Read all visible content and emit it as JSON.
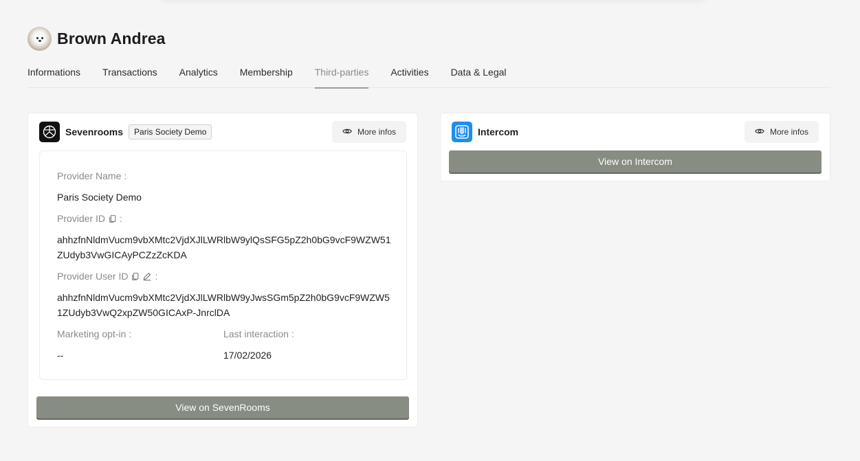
{
  "profile": {
    "name": "Brown Andrea"
  },
  "tabs": [
    {
      "label": "Informations"
    },
    {
      "label": "Transactions"
    },
    {
      "label": "Analytics"
    },
    {
      "label": "Membership"
    },
    {
      "label": "Third-parties",
      "active": true
    },
    {
      "label": "Activities"
    },
    {
      "label": "Data & Legal"
    }
  ],
  "sevenrooms": {
    "title": "Sevenrooms",
    "tag": "Paris Society Demo",
    "more_label": "More infos",
    "provider_name_label": "Provider Name",
    "provider_name": "Paris Society Demo",
    "provider_id_label": "Provider ID",
    "provider_id": "ahhzfnNldmVucm9vbXMtc2VjdXJlLWRlbW9ylQsSFG5pZ2h0bG9vcF9WZW51ZUdyb3VwGICAyPCZzZcKDA",
    "provider_user_id_label": "Provider User ID",
    "provider_user_id": "ahhzfnNldmVucm9vbXMtc2VjdXJlLWRlbW9yJwsSGm5pZ2h0bG9vcF9WZW51ZUdyb3VwQ2xpZW50GICAxP-JnrclDA",
    "marketing_label": "Marketing opt-in",
    "marketing_value": "--",
    "last_interaction_label": "Last interaction",
    "last_interaction_value": "17/02/2026",
    "view_label": "View on SevenRooms"
  },
  "intercom": {
    "title": "Intercom",
    "more_label": "More infos",
    "view_label": "View on Intercom"
  },
  "colors": {
    "button": "#878d82",
    "intercom_brand": "#1f8ded",
    "active_tab": "#8a8a8a"
  }
}
